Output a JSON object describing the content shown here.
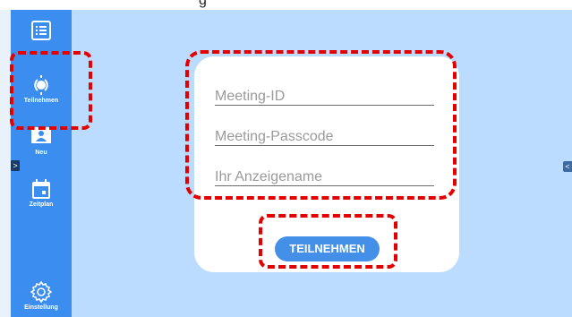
{
  "top_caption": "g",
  "sidebar": {
    "items": [
      {
        "label": "",
        "icon": "list-icon"
      },
      {
        "label": "Teilnehmen",
        "icon": "join-icon"
      },
      {
        "label": "Neu",
        "icon": "presenter-icon"
      },
      {
        "label": "Zeitplan",
        "icon": "calendar-icon"
      },
      {
        "label": "Einstellung",
        "icon": "gear-icon"
      }
    ],
    "expand_glyph": ">"
  },
  "main": {
    "collapse_glyph": "<"
  },
  "form": {
    "meeting_id_placeholder": "Meeting-ID",
    "passcode_placeholder": "Meeting-Passcode",
    "name_placeholder": "Ihr Anzeigename",
    "join_label": "TEILNEHMEN"
  },
  "colors": {
    "sidebar": "#3b8df0",
    "main_bg": "#bcdcff",
    "button": "#4490e8",
    "highlight": "#e30000"
  }
}
